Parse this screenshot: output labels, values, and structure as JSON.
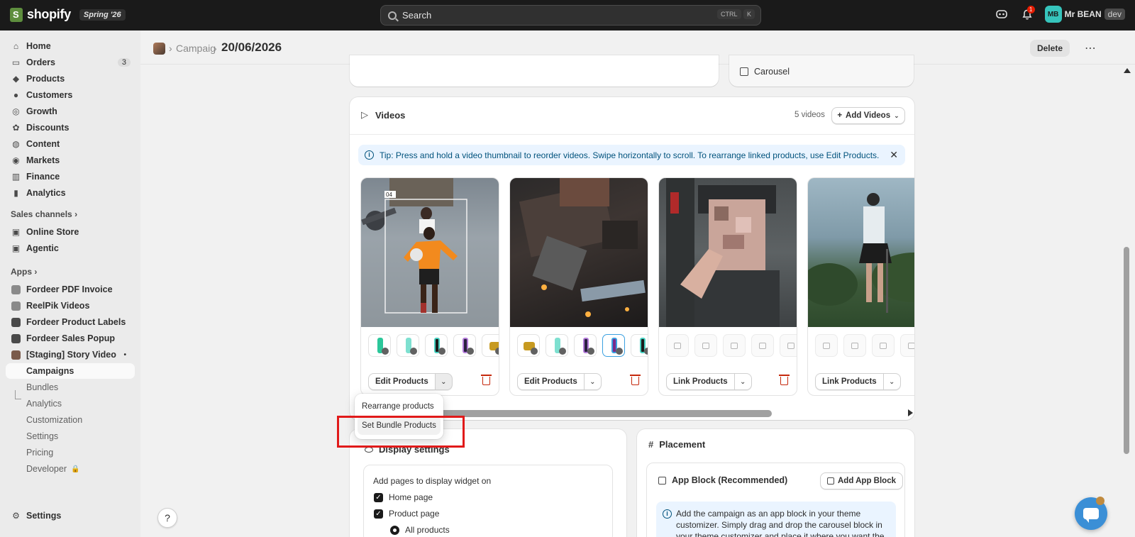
{
  "topbar": {
    "brand": "shopify",
    "edition": "Spring '26",
    "search_placeholder": "Search",
    "shortcut_ctrl": "CTRL",
    "shortcut_key": "K",
    "notification_count": "1",
    "avatar_initials": "MB",
    "user_name": "Mr BEAN",
    "store_tag": "dev"
  },
  "sidebar": {
    "items": [
      {
        "label": "Home",
        "icon": "home-icon"
      },
      {
        "label": "Orders",
        "icon": "inbox-icon",
        "count": "3"
      },
      {
        "label": "Products",
        "icon": "tag-icon"
      },
      {
        "label": "Customers",
        "icon": "person-icon"
      },
      {
        "label": "Growth",
        "icon": "target-icon"
      },
      {
        "label": "Discounts",
        "icon": "discount-icon"
      },
      {
        "label": "Content",
        "icon": "globe-icon"
      },
      {
        "label": "Markets",
        "icon": "globe-icon"
      },
      {
        "label": "Finance",
        "icon": "bank-icon"
      },
      {
        "label": "Analytics",
        "icon": "bar-chart-icon"
      }
    ],
    "sales_channels_label": "Sales channels",
    "channels": [
      {
        "label": "Online Store"
      },
      {
        "label": "Agentic"
      }
    ],
    "apps_label": "Apps",
    "apps": [
      {
        "label": "Fordeer PDF Invoice"
      },
      {
        "label": "ReelPik Videos"
      },
      {
        "label": "Fordeer Product Labels"
      },
      {
        "label": "Fordeer Sales Popup"
      },
      {
        "label": "[Staging] Story Video"
      }
    ],
    "subitems": [
      {
        "label": "Campaigns"
      },
      {
        "label": "Bundles"
      },
      {
        "label": "Analytics"
      },
      {
        "label": "Customization"
      },
      {
        "label": "Settings"
      },
      {
        "label": "Pricing"
      },
      {
        "label": "Developer"
      }
    ],
    "settings_label": "Settings"
  },
  "header": {
    "breadcrumb_parent": "Campaig",
    "title": "20/06/2026",
    "delete_label": "Delete"
  },
  "carousel_label": "Carousel",
  "videos": {
    "title": "Videos",
    "count_label": "5 videos",
    "add_label": "Add Videos",
    "tip": "Tip: Press and hold a video thumbnail to reorder videos. Swipe horizontally to scroll. To rearrange linked products, use Edit Products.",
    "cards": [
      {
        "action": "Edit Products"
      },
      {
        "action": "Edit Products"
      },
      {
        "action": "Link Products"
      },
      {
        "action": "Link Products"
      }
    ],
    "overlay_number": "04",
    "menu": {
      "rearrange": "Rearrange products",
      "set_bundle": "Set Bundle Products"
    }
  },
  "display_settings": {
    "title": "Display settings",
    "pages_label": "Add pages to display widget on",
    "home_page": "Home page",
    "product_page": "Product page",
    "all_products": "All products"
  },
  "placement": {
    "title": "Placement",
    "app_block_title": "App Block (Recommended)",
    "add_app_block": "Add App Block",
    "info": "Add the campaign as an app block in your theme customizer. Simply drag and drop the carousel block in your theme customizer and place it where you want the"
  }
}
